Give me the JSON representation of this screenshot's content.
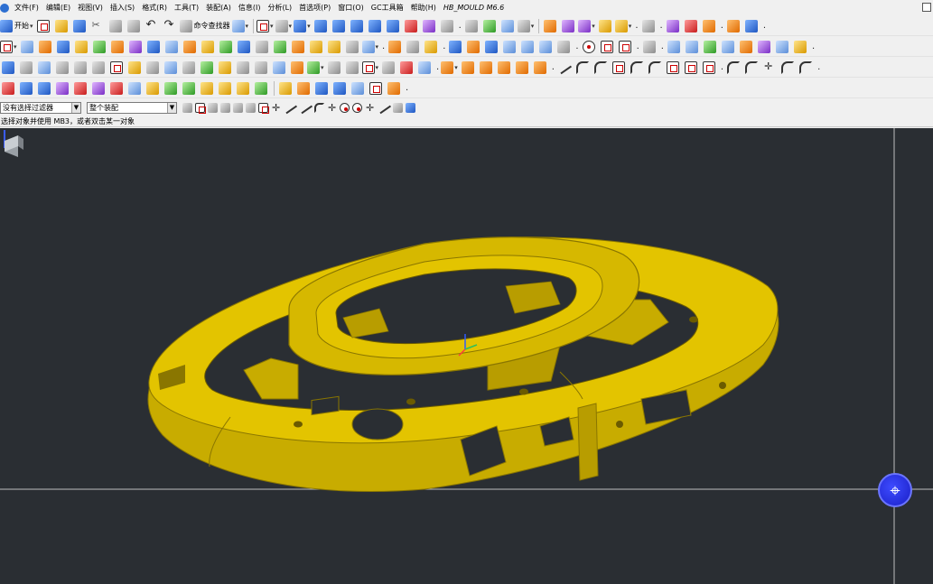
{
  "menubar": {
    "items": [
      "文件(F)",
      "编辑(E)",
      "视图(V)",
      "插入(S)",
      "格式(R)",
      "工具(T)",
      "装配(A)",
      "信息(I)",
      "分析(L)",
      "首选项(P)",
      "窗口(O)",
      "GC工具箱",
      "帮助(H)",
      "HB_MOULD M6.6"
    ]
  },
  "toolbar1": {
    "start_label": "开始",
    "command_finder_label": "命令查找器"
  },
  "filter_bar": {
    "selection_filter": "没有选择过滤器",
    "assembly_scope": "整个装配"
  },
  "status": {
    "prompt": "选择对象并使用 MB3，或者双击某一对象"
  },
  "viewport": {
    "background": "#2a2e33",
    "model_color": "#e3c400",
    "model_shadow": "#b89d00",
    "crosshair_color": "#c8c8c8",
    "orb_color": "#2229d6"
  },
  "icons": {
    "nav_orb": "navigation-crosshair-icon",
    "view_triad": "view-triad-icon"
  }
}
